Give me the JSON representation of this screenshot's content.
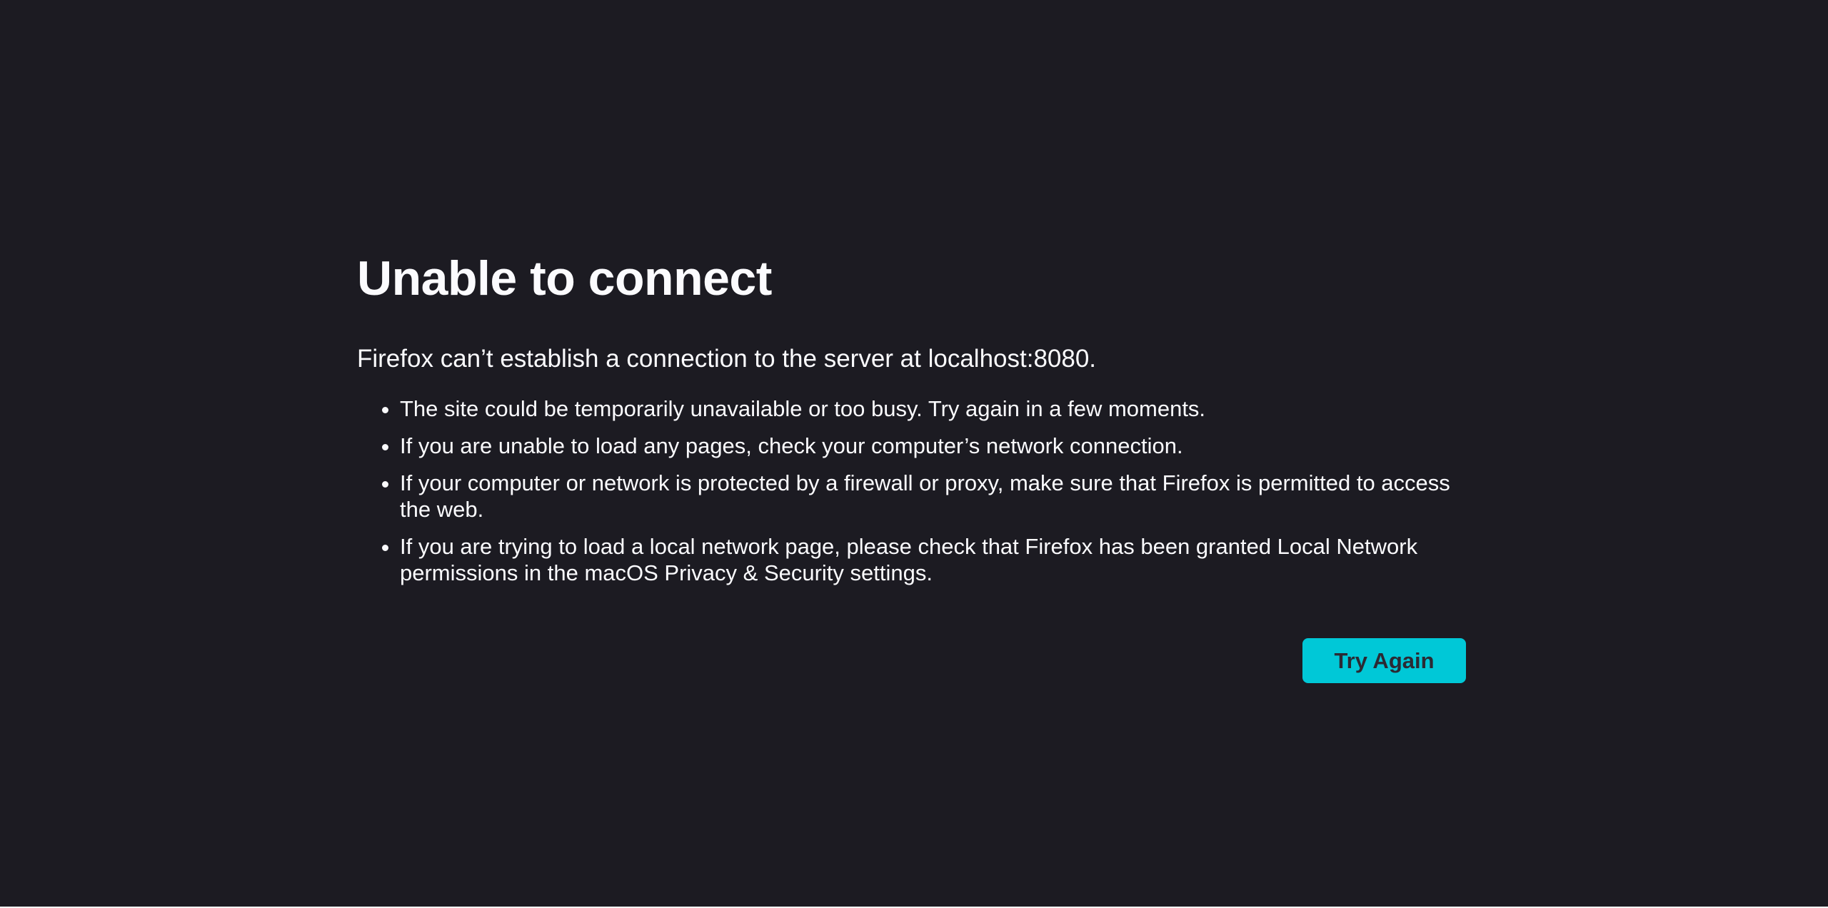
{
  "error_page": {
    "title": "Unable to connect",
    "description": "Firefox can’t establish a connection to the server at localhost:8080.",
    "reasons": [
      "The site could be temporarily unavailable or too busy. Try again in a few moments.",
      "If you are unable to load any pages, check your computer’s network connection.",
      "If your computer or network is protected by a firewall or proxy, make sure that Firefox is permitted to access the web.",
      "If you are trying to load a local network page, please check that Firefox has been granted Local Network permissions in the macOS Privacy & Security settings."
    ],
    "try_again_label": "Try Again"
  },
  "colors": {
    "background": "#1c1b22",
    "text": "#fbfbfe",
    "button_bg": "#00c8d7",
    "button_text": "#2b2a33"
  }
}
